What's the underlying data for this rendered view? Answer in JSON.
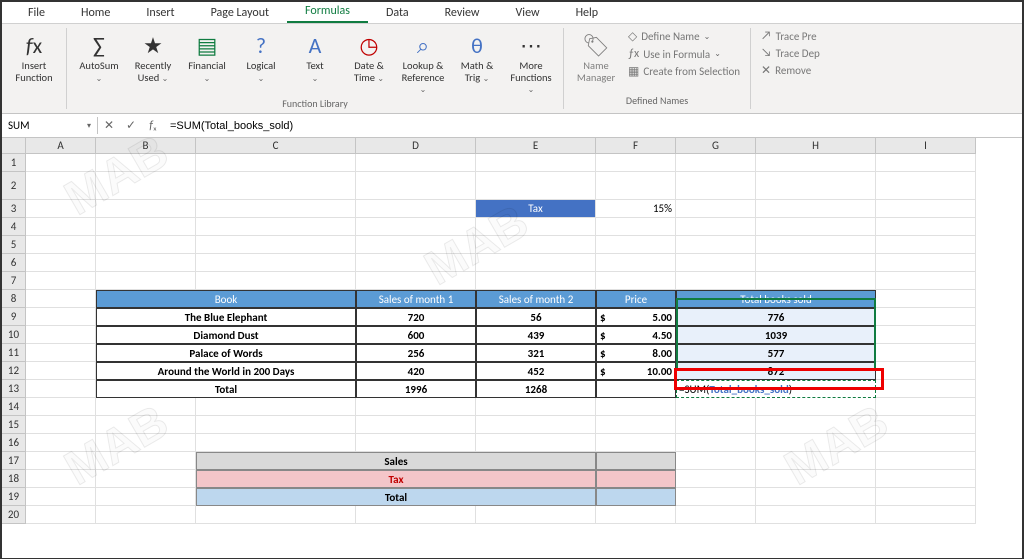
{
  "tabs": [
    "File",
    "Home",
    "Insert",
    "Page Layout",
    "Formulas",
    "Data",
    "Review",
    "View",
    "Help"
  ],
  "active_tab": 4,
  "ribbon": {
    "insert_function": "Insert Function",
    "autosum": "AutoSum",
    "recently": "Recently Used",
    "financial": "Financial",
    "logical": "Logical",
    "text": "Text",
    "datetime": "Date & Time",
    "lookup": "Lookup & Reference",
    "math": "Math & Trig",
    "more": "More Functions",
    "group_funclib": "Function Library",
    "name_mgr": "Name Manager",
    "define_name": "Define Name",
    "use_in_formula": "Use in Formula",
    "create_sel": "Create from Selection",
    "group_defnames": "Defined Names",
    "trace_pre": "Trace Pre",
    "trace_dep": "Trace Dep",
    "remove": "Remove"
  },
  "name_box": "SUM",
  "formula_bar": "=SUM(Total_books_sold)",
  "col_headers": [
    "A",
    "B",
    "C",
    "D",
    "E",
    "F",
    "G",
    "H",
    "I"
  ],
  "row_headers": [
    "1",
    "2",
    "3",
    "4",
    "5",
    "6",
    "7",
    "8",
    "9",
    "10",
    "11",
    "12",
    "13",
    "14",
    "15",
    "16",
    "17",
    "18",
    "19",
    "20"
  ],
  "tax_label": "Tax",
  "tax_value": "15%",
  "tbl_headers": [
    "Book",
    "Sales of month 1",
    "Sales of month 2",
    "Price",
    "Total books sold"
  ],
  "books": [
    {
      "name": "The Blue Elephant",
      "m1": "720",
      "m2": "56",
      "price_sym": "$",
      "price": "5.00",
      "total": "776"
    },
    {
      "name": "Diamond Dust",
      "m1": "600",
      "m2": "439",
      "price_sym": "$",
      "price": "4.50",
      "total": "1039"
    },
    {
      "name": "Palace of Words",
      "m1": "256",
      "m2": "321",
      "price_sym": "$",
      "price": "8.00",
      "total": "577"
    },
    {
      "name": "Around the World in 200 Days",
      "m1": "420",
      "m2": "452",
      "price_sym": "$",
      "price": "10.00",
      "total": "872"
    }
  ],
  "totals": {
    "label": "Total",
    "m1": "1996",
    "m2": "1268",
    "formula": "=SUM(Total_books_sold)"
  },
  "sales_label": "Sales",
  "tax_row_label": "Tax",
  "grand_total_label": "Total",
  "watermark": "MAB"
}
